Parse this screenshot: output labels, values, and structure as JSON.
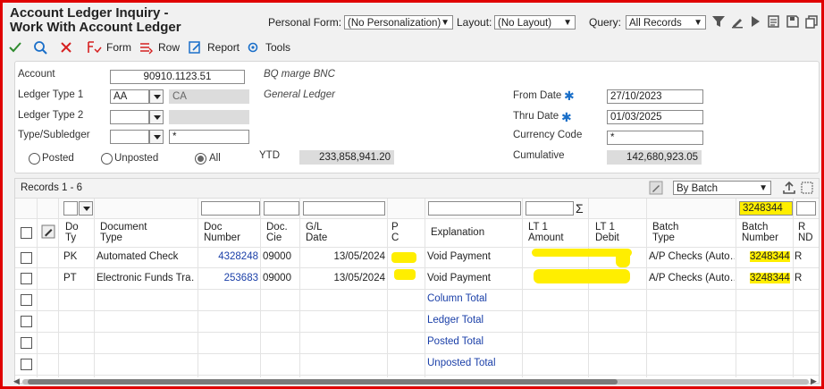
{
  "header": {
    "title_line1": "Account Ledger Inquiry -",
    "title_line2": "Work With Account Ledger",
    "personal_form_label": "Personal Form:",
    "personal_form_value": "(No Personalization)",
    "layout_label": "Layout:",
    "layout_value": "(No Layout)",
    "query_label": "Query:",
    "query_value": "All Records"
  },
  "toolbar": {
    "form": "Form",
    "row": "Row",
    "report": "Report",
    "tools": "Tools"
  },
  "filters": {
    "account_label": "Account",
    "account_value": "90910.1123.51",
    "account_desc": "BQ marge BNC",
    "ledger_type1_label": "Ledger Type 1",
    "ledger_type1_value": "AA",
    "ledger_type1_code": "CA",
    "ledger_desc": "General Ledger",
    "ledger_type2_label": "Ledger Type 2",
    "type_subledger_label": "Type/Subledger",
    "subledger_value": "*",
    "from_date_label": "From Date",
    "from_date_value": "27/10/2023",
    "thru_date_label": "Thru Date",
    "thru_date_value": "01/03/2025",
    "currency_code_label": "Currency Code",
    "currency_code_value": "*",
    "radio_posted": "Posted",
    "radio_unposted": "Unposted",
    "radio_all": "All",
    "ytd_label": "YTD",
    "ytd_value": "233,858,941.20",
    "cumulative_label": "Cumulative",
    "cumulative_value": "142,680,923.05"
  },
  "grid": {
    "records": "Records 1 - 6",
    "view_by": "By Batch",
    "batch_filter": "3248344",
    "columns": {
      "do_ty": [
        "Do",
        "Ty"
      ],
      "doc_type": [
        "Document",
        "Type"
      ],
      "doc_number": [
        "Doc",
        "Number"
      ],
      "doc_cie": [
        "Doc.",
        "Cie"
      ],
      "gl_date": [
        "G/L",
        "Date"
      ],
      "pc": [
        "P",
        "C"
      ],
      "explanation": "Explanation",
      "lt1_amount": [
        "LT 1",
        "Amount"
      ],
      "lt1_debit": [
        "LT 1",
        "Debit"
      ],
      "batch_type": [
        "Batch",
        "Type"
      ],
      "batch_number": [
        "Batch",
        "Number"
      ],
      "rnd": [
        "R",
        "ND"
      ]
    },
    "rows": [
      {
        "do_ty": "PK",
        "doc_type": "Automated Check",
        "doc_number": "4328248",
        "doc_cie": "09000",
        "gl_date": "13/05/2024",
        "explanation": "Void Payment",
        "batch_type": "A/P Checks (Auto…",
        "batch_number": "3248344",
        "rnd": "R"
      },
      {
        "do_ty": "PT",
        "doc_type": "Electronic Funds Tra…",
        "doc_number": "253683",
        "doc_cie": "09000",
        "gl_date": "13/05/2024",
        "explanation": "Void Payment",
        "batch_type": "A/P Checks (Auto…",
        "batch_number": "3248344",
        "rnd": "R"
      }
    ],
    "totals": [
      "Column Total",
      "Ledger Total",
      "Posted Total",
      "Unposted Total"
    ]
  },
  "colors": {
    "border": "#e00000",
    "highlight": "#ffee00",
    "link": "#1a3fa8",
    "accent": "#1a6fc9"
  }
}
